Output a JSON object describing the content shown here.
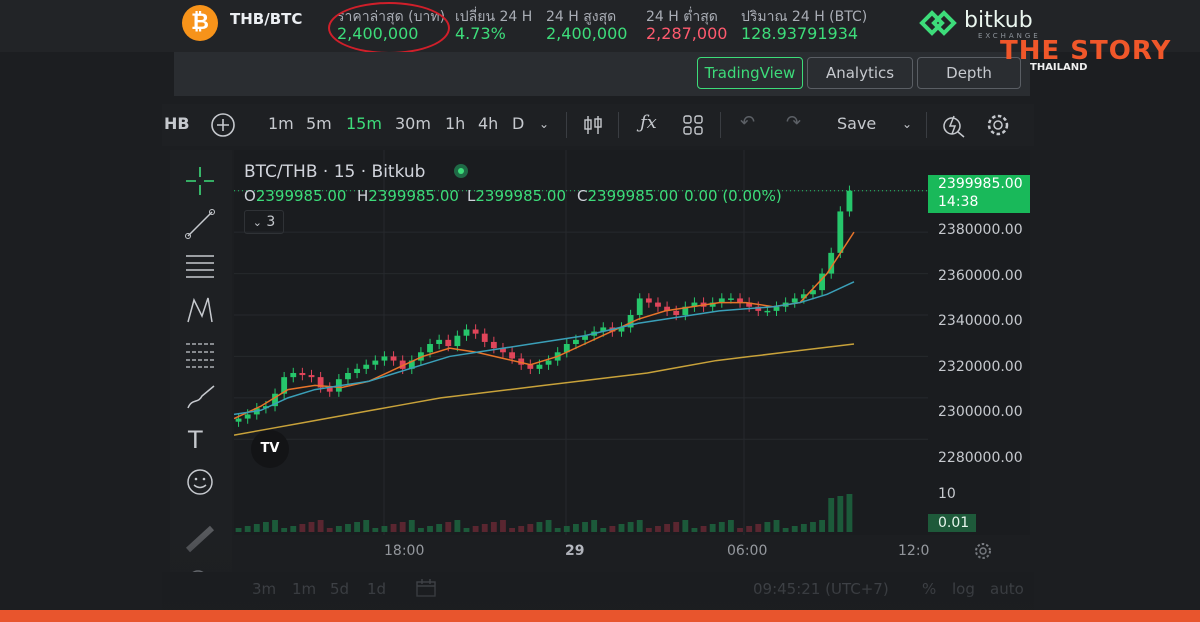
{
  "header": {
    "pair": "THB/BTC",
    "coin_symbol": "₿",
    "stats": [
      {
        "label": "ราคาล่าสุด (บาท)",
        "value": "2,400,000",
        "color": "#3ddc7a"
      },
      {
        "label": "เปลี่ยน 24 H",
        "value": "4.73%",
        "color": "#3ddc7a"
      },
      {
        "label": "24 H สูงสุด",
        "value": "2,400,000",
        "color": "#3ddc7a"
      },
      {
        "label": "24 H ต่ำสุด",
        "value": "2,287,000",
        "color": "#ff5a6e"
      },
      {
        "label": "ปริมาณ 24 H (BTC)",
        "value": "128.93791934",
        "color": "#3ddc7a"
      }
    ],
    "brand": {
      "name": "bitkub",
      "sub": "EXCHANGE"
    },
    "watermark": {
      "name": "THE STORY",
      "sub": "THAILAND"
    }
  },
  "tabs": [
    "TradingView",
    "Analytics",
    "Depth"
  ],
  "toolbar": {
    "symbol_fragment": "HB",
    "intervals": [
      "1m",
      "5m",
      "15m",
      "30m",
      "1h",
      "4h",
      "D"
    ],
    "active_interval": "15m",
    "save_label": "Save"
  },
  "chart": {
    "legend_title": "BTC/THB · 15 · Bitkub",
    "ohlc": {
      "o_label": "O",
      "o": "2399985.00",
      "h_label": "H",
      "h": "2399985.00",
      "l_label": "L",
      "l": "2399985.00",
      "c_label": "C",
      "c": "0.00 (0.00%)",
      "c_price": "2399985.00"
    },
    "indicators_count": "3",
    "price_axis": [
      "2380000.00",
      "2360000.00",
      "2340000.00",
      "2320000.00",
      "2300000.00",
      "2280000.00"
    ],
    "last_price": "2399985.00",
    "countdown": "14:38",
    "volume_axis": "10",
    "last_volume": "0.01",
    "time_axis": [
      "18:00",
      "29",
      "06:00",
      "12:0"
    ]
  },
  "bottom": {
    "ranges": [
      "3m",
      "1m",
      "5d",
      "1d"
    ],
    "clock": "09:45:21 (UTC+7)",
    "options": [
      "%",
      "log",
      "auto"
    ]
  },
  "chart_data": {
    "type": "candlestick",
    "title": "BTC/THB · 15 · Bitkub",
    "ylim": [
      2270000,
      2410000
    ],
    "x_ticks": [
      "18:00",
      "29",
      "06:00",
      "12:0"
    ],
    "series": [
      {
        "name": "price",
        "values": [
          2290000,
          2292000,
          2295000,
          2296000,
          2302000,
          2310000,
          2312000,
          2311000,
          2310000,
          2305000,
          2303000,
          2309000,
          2312000,
          2314000,
          2316000,
          2318000,
          2320000,
          2318000,
          2314000,
          2318000,
          2322000,
          2326000,
          2328000,
          2325000,
          2330000,
          2333000,
          2331000,
          2327000,
          2324000,
          2322000,
          2319000,
          2316000,
          2314000,
          2316000,
          2318000,
          2322000,
          2326000,
          2328000,
          2330000,
          2332000,
          2334000,
          2332000,
          2334000,
          2340000,
          2348000,
          2346000,
          2344000,
          2342000,
          2340000,
          2344000,
          2346000,
          2344000,
          2346000,
          2348000,
          2348000,
          2346000,
          2344000,
          2342000,
          2342000,
          2344000,
          2346000,
          2348000,
          2350000,
          2352000,
          2360000,
          2370000,
          2390000,
          2399985
        ]
      },
      {
        "name": "ma-fast",
        "values": [
          2290000,
          2296000,
          2304000,
          2306000,
          2305000,
          2308000,
          2314000,
          2320000,
          2324000,
          2322000,
          2319000,
          2316000,
          2320000,
          2326000,
          2332000,
          2338000,
          2342000,
          2344000,
          2346000,
          2346000,
          2344000,
          2346000,
          2360000,
          2380000
        ]
      },
      {
        "name": "ma-mid",
        "values": [
          2292000,
          2294000,
          2300000,
          2304000,
          2306000,
          2308000,
          2312000,
          2316000,
          2320000,
          2322000,
          2324000,
          2326000,
          2328000,
          2330000,
          2333000,
          2336000,
          2338000,
          2340000,
          2342000,
          2343000,
          2344000,
          2346000,
          2350000,
          2356000
        ]
      },
      {
        "name": "ma-slow",
        "values": [
          2282000,
          2285000,
          2288000,
          2291000,
          2294000,
          2297000,
          2300000,
          2302000,
          2304000,
          2306000,
          2308000,
          2310000,
          2312000,
          2315000,
          2318000,
          2320000,
          2322000,
          2324000,
          2326000
        ]
      }
    ]
  }
}
